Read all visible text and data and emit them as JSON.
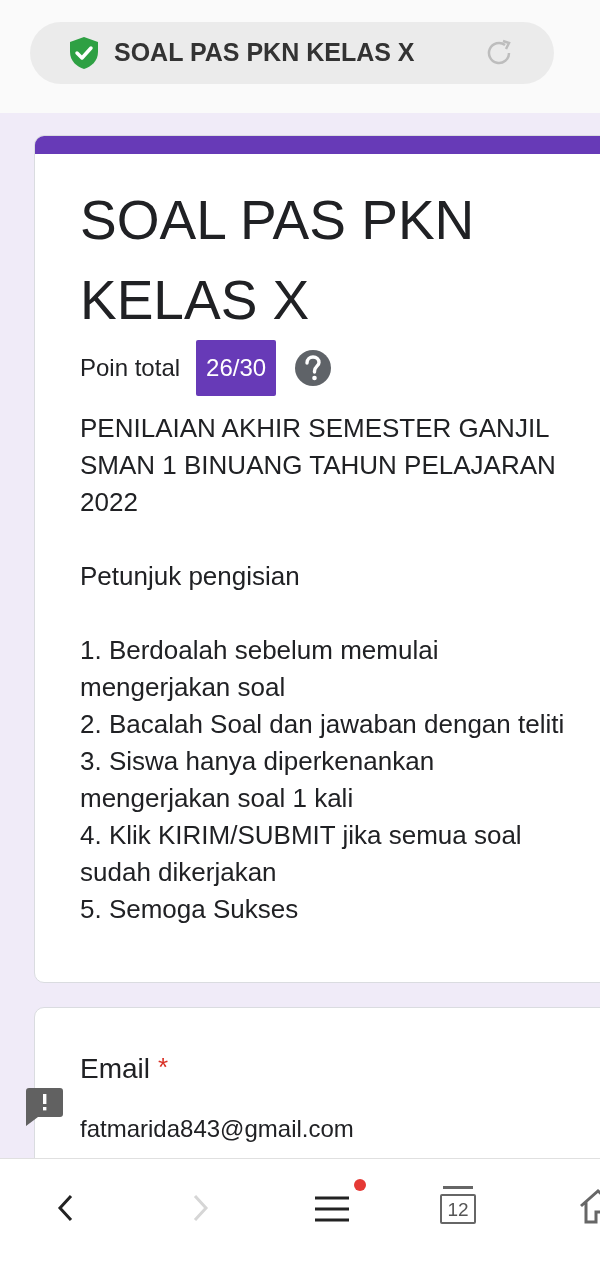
{
  "address_bar": {
    "title": "SOAL PAS PKN KELAS X",
    "secure": true
  },
  "form_header": {
    "title": "SOAL PAS PKN KELAS X",
    "points_label": "Poin total",
    "points": "26/30",
    "description": [
      "PENILAIAN AKHIR SEMESTER GANJIL SMAN 1 BINUANG TAHUN PELAJARAN 2022",
      "Petunjuk pengisian"
    ],
    "instructions": [
      "1. Berdoalah sebelum memulai mengerjakan soal",
      "2. Bacalah Soal dan jawaban dengan teliti",
      "3. Siswa hanya diperkenankan mengerjakan soal 1 kali",
      "4. Klik KIRIM/SUBMIT jika semua soal sudah dikerjakan",
      "5. Semoga Sukses"
    ]
  },
  "question": {
    "label": "Email",
    "required": true,
    "required_mark": "*",
    "answer": "fatmarida843@gmail.com"
  },
  "bottom_nav": [
    {
      "kind": "back",
      "disabled": false
    },
    {
      "kind": "forward",
      "disabled": true
    },
    {
      "kind": "menu",
      "disabled": false,
      "notification": true
    },
    {
      "kind": "tabs",
      "disabled": false,
      "count": "12"
    },
    {
      "kind": "home",
      "disabled": false
    }
  ]
}
